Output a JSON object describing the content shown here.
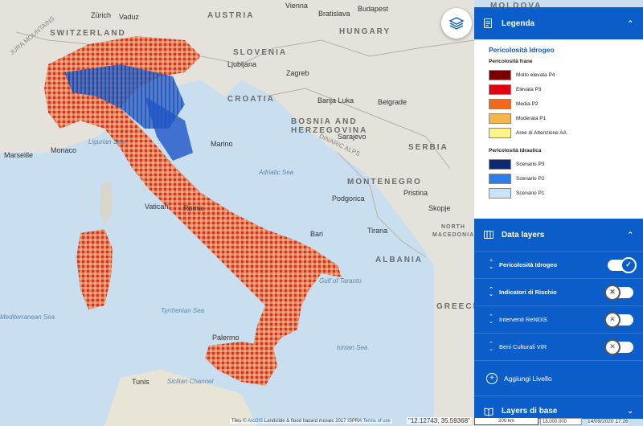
{
  "map": {
    "countries": [
      {
        "name": "AUSTRIA"
      },
      {
        "name": "HUNGARY"
      },
      {
        "name": "SLOVENIA"
      },
      {
        "name": "CROATIA"
      },
      {
        "name": "BOSNIA AND"
      },
      {
        "name": "HERZEGOVINA"
      },
      {
        "name": "SERBIA"
      },
      {
        "name": "MONTENEGRO"
      },
      {
        "name": "ALBANIA"
      },
      {
        "name": "GREECE"
      },
      {
        "name": "NORTH"
      },
      {
        "name": "MACEDONIA"
      },
      {
        "name": "SWITZERLAND"
      },
      {
        "name": "MOLDOVA"
      }
    ],
    "cities": [
      "Zürich",
      "Vaduz",
      "Vienna",
      "Budapest",
      "Bratislava",
      "Ljubljana",
      "Zagreb",
      "Banja Luka",
      "Belgrade",
      "Sarajevo",
      "Podgorica",
      "Pristina",
      "Skopje",
      "Tirana",
      "Marino",
      "Vatican",
      "Roma",
      "Monaco",
      "Marseille",
      "Palermo",
      "Tunis",
      "Bari"
    ],
    "seas": [
      "Ligurian Sea",
      "Adriatic Sea",
      "Tyrrhenian Sea",
      "Ionian Sea",
      "Gulf of Taranto",
      "Sicilian Channel",
      "Mediterranean Sea"
    ],
    "regions": [
      "JURA MOUNTAINS",
      "DINARIC ALPS"
    ]
  },
  "panel": {
    "legend_header": "Legenda",
    "legend_title": "Pericolosità Idrogeo",
    "groups": [
      {
        "title": "Pericolosità frane",
        "items": [
          {
            "label": "Molto elevata P4",
            "color": "#7a0000"
          },
          {
            "label": "Elevata P3",
            "color": "#e00012"
          },
          {
            "label": "Media P2",
            "color": "#f06a1e"
          },
          {
            "label": "Moderata P1",
            "color": "#f4b54a"
          },
          {
            "label": "Aree di Attenzione AA",
            "color": "#fff38a"
          }
        ]
      },
      {
        "title": "Pericolosità idraulica",
        "items": [
          {
            "label": "Scenario P3",
            "color": "#0a2a78"
          },
          {
            "label": "Scenario P2",
            "color": "#2c7ee8"
          },
          {
            "label": "Scenario P1",
            "color": "#c7e4f7"
          }
        ]
      }
    ],
    "data_layers_header": "Data layers",
    "layers": [
      {
        "label": "Pericolosità Idrogeo",
        "on": true
      },
      {
        "label": "Indicatori di Rischio",
        "on": false
      },
      {
        "label": "Interventi ReNDiS",
        "on": false
      },
      {
        "label": "Beni Culturali VIR",
        "on": false
      }
    ],
    "add_layer": "Aggiungi Livello",
    "base_layers_header": "Layers di base"
  },
  "status": {
    "attribution_prefix": "Tiles ©",
    "attribution_link1": "ArcGIS",
    "attribution_text": "Landslide & flood hazard mosaic 2017 ISPRA",
    "attribution_link2": "Terms of use",
    "coords": "\"12.12743, 35.59368\"",
    "scale": "200 km",
    "zoom": "18.000.000",
    "date": "14/09/2020 17:26"
  }
}
